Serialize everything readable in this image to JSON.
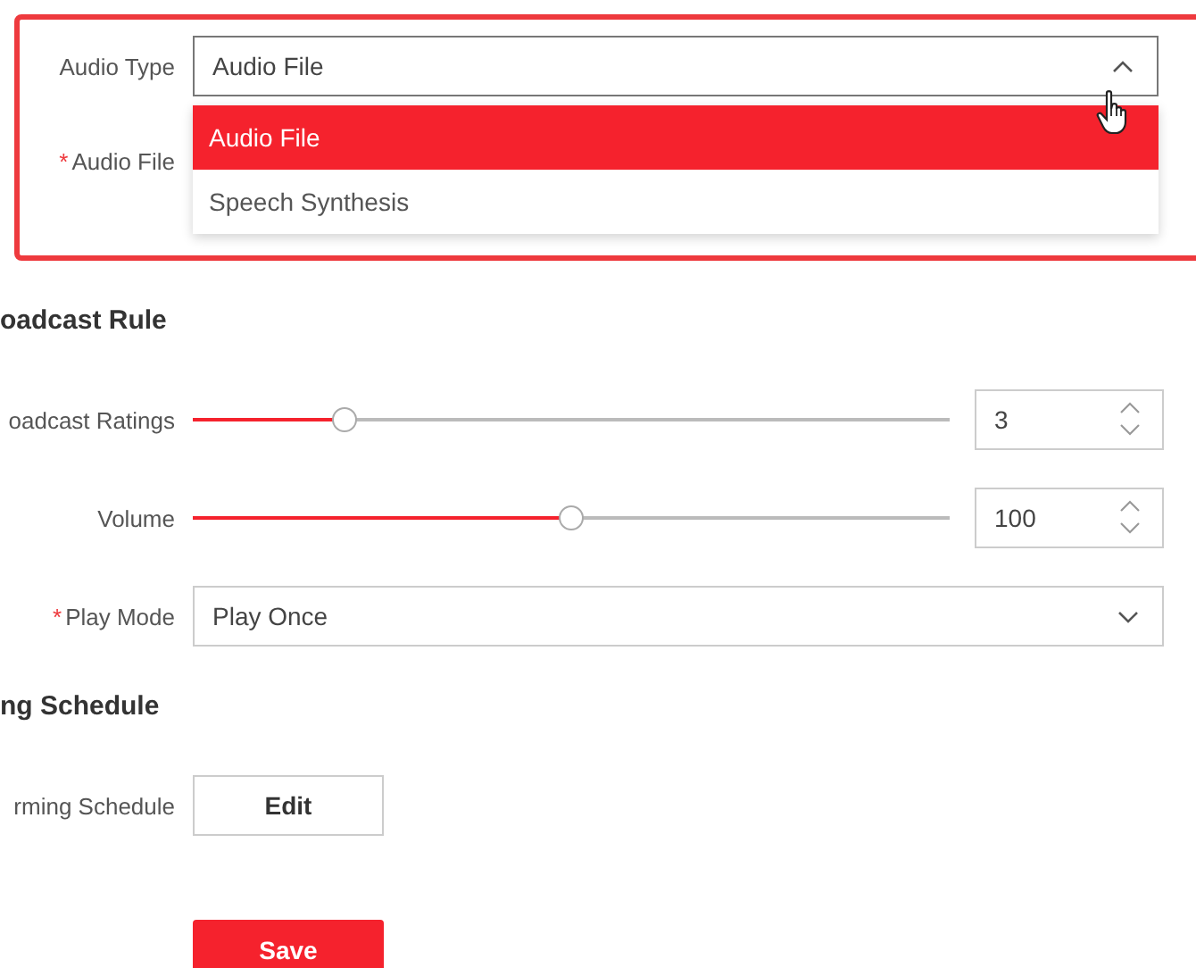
{
  "highlighted_group": {
    "rows": [
      {
        "kind": "select",
        "label": "Audio Type",
        "value": "Audio File",
        "expanded": true,
        "options": [
          {
            "label": "Audio File",
            "selected": true
          },
          {
            "label": "Speech Synthesis",
            "selected": false
          }
        ]
      },
      {
        "kind": "covered",
        "label": "Audio File",
        "asterisk": "*"
      }
    ]
  },
  "sections": [
    {
      "title": "oadcast Rule",
      "rows": [
        {
          "kind": "slider",
          "label": "oadcast Ratings",
          "level": 0.2,
          "value": "3"
        },
        {
          "kind": "slider",
          "label": "Volume",
          "level": 0.5,
          "value": "100"
        },
        {
          "kind": "select",
          "label": "Play Mode",
          "asterisk": "*",
          "value": "Play Once",
          "expanded": false
        }
      ]
    },
    {
      "title": "ng Schedule",
      "rows": [
        {
          "kind": "button",
          "label": "rming Schedule",
          "button": "Edit"
        }
      ]
    }
  ],
  "save_button": "Save"
}
